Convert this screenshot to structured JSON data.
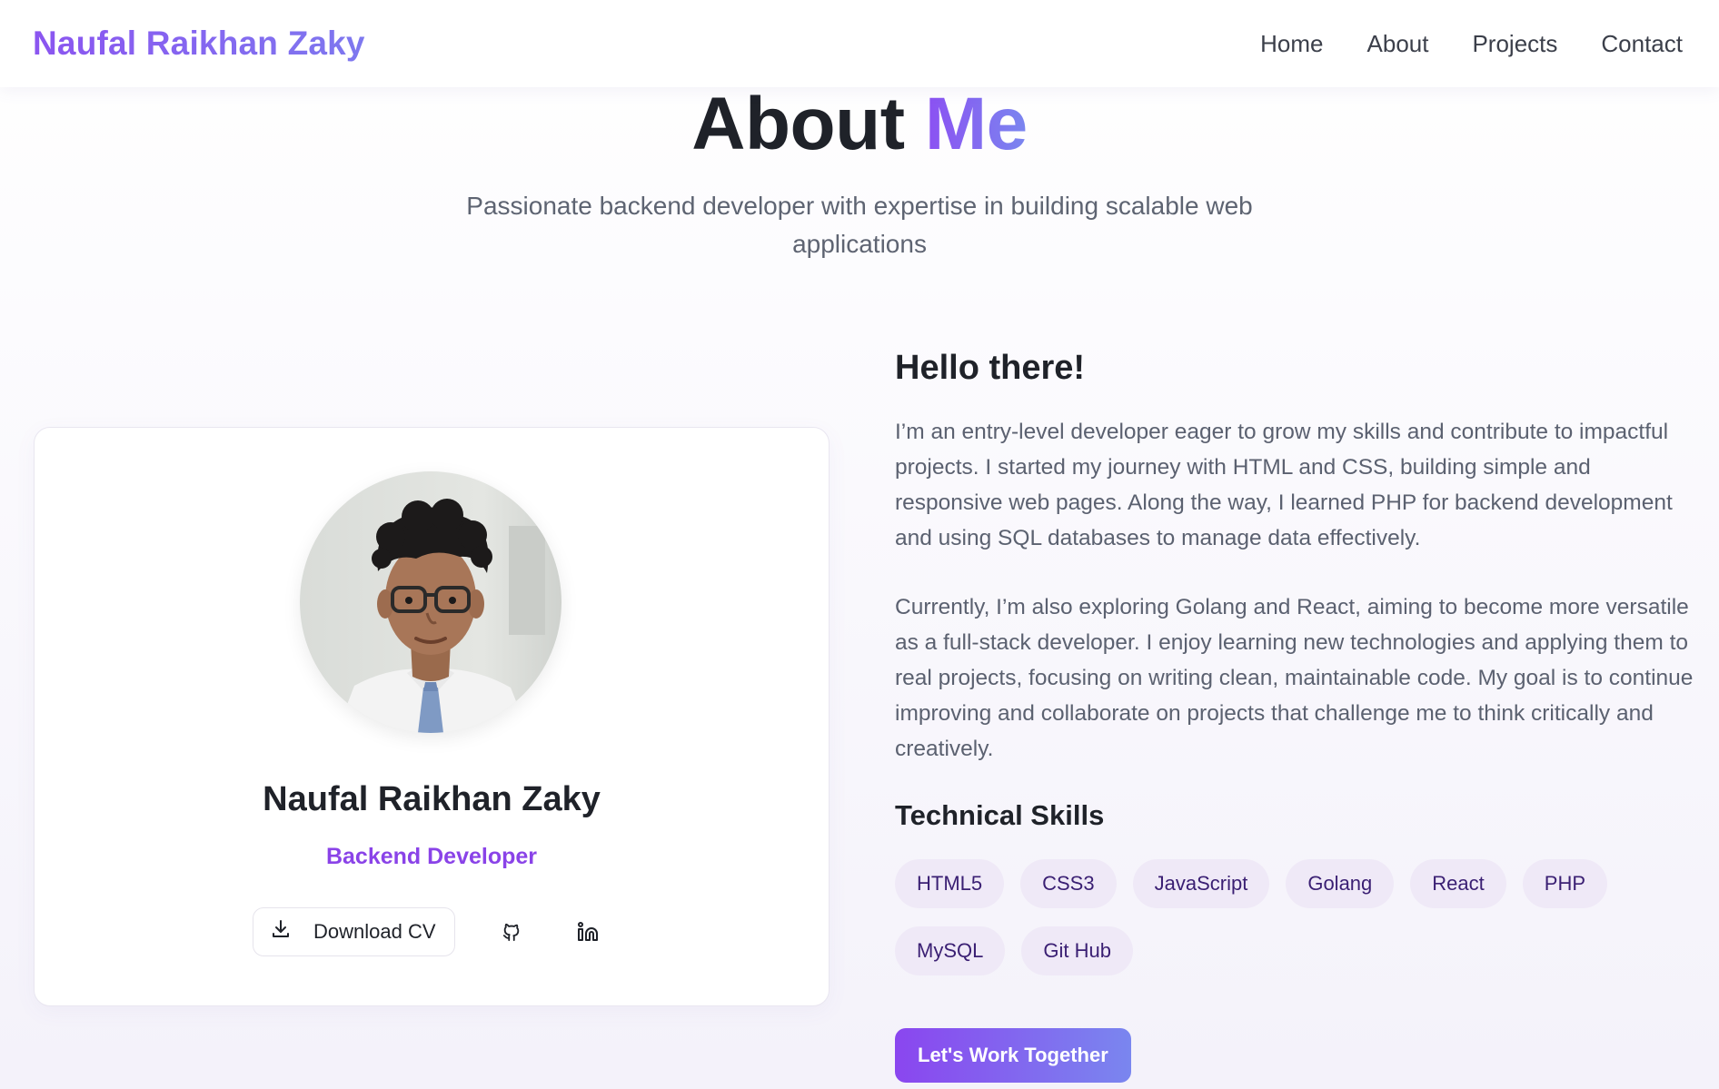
{
  "nav": {
    "brand": "Naufal Raikhan Zaky",
    "links": [
      "Home",
      "About",
      "Projects",
      "Contact"
    ]
  },
  "hero": {
    "title_main": "About",
    "title_accent": "Me",
    "subtitle": "Passionate backend developer with expertise in building scalable web applications"
  },
  "profile": {
    "name": "Naufal Raikhan Zaky",
    "role": "Backend Developer",
    "download_label": "Download CV",
    "icons": [
      "download-icon",
      "github-icon",
      "linkedin-icon"
    ]
  },
  "about": {
    "greeting": "Hello there!",
    "paragraphs": [
      "I’m an entry-level developer eager to grow my skills and contribute to impactful projects. I started my journey with HTML and CSS, building simple and responsive web pages. Along the way, I learned PHP for backend development and using SQL databases to manage data effectively.",
      "Currently, I’m also exploring Golang and React, aiming to become more versatile as a full-stack developer. I enjoy learning new technologies and applying them to real projects, focusing on writing clean, maintainable code. My goal is to continue improving and collaborate on projects that challenge me to think critically and creatively."
    ],
    "skills_title": "Technical Skills",
    "skills": [
      "HTML5",
      "CSS3",
      "JavaScript",
      "Golang",
      "React",
      "PHP",
      "MySQL",
      "Git Hub"
    ],
    "cta": "Let's Work Together"
  },
  "colors": {
    "accent": "#8a43e8",
    "accent_gradient_end": "#7a86ef",
    "skill_bg": "#efe9f7",
    "skill_text": "#3a1f73"
  }
}
